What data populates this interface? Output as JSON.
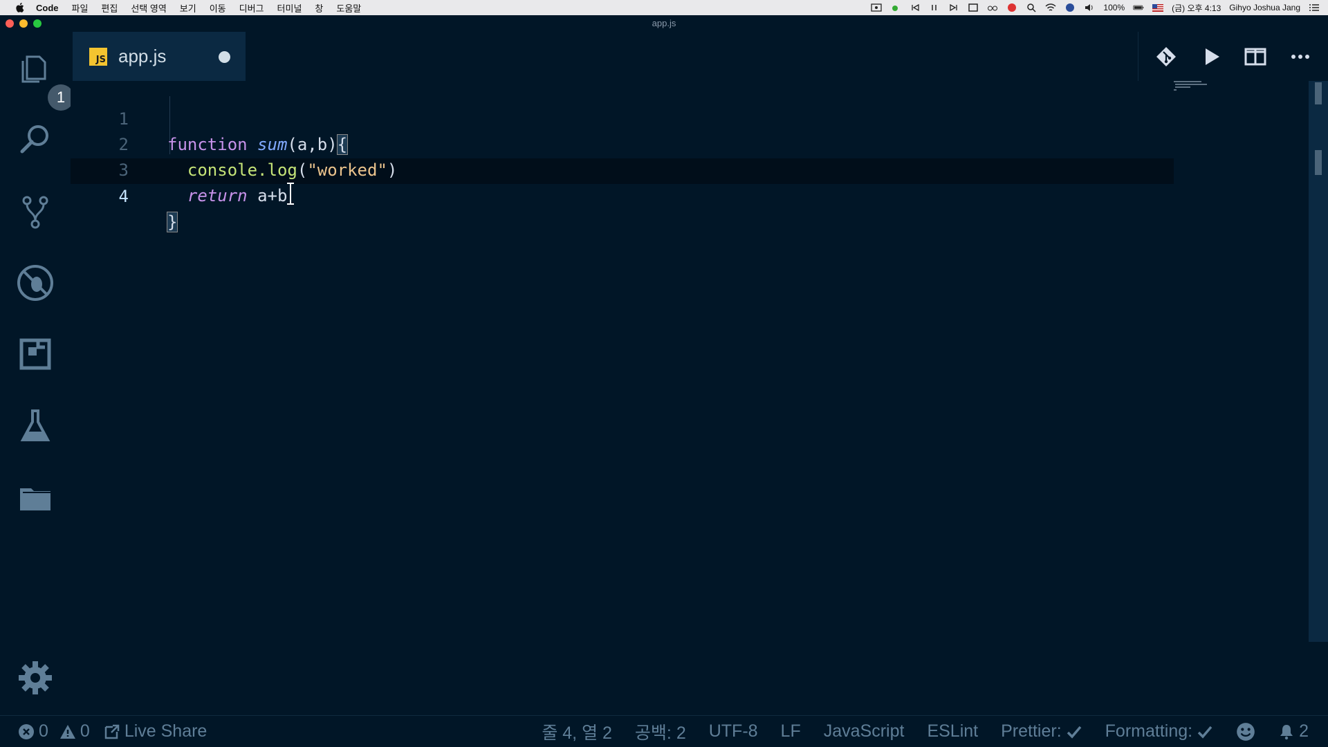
{
  "menubar": {
    "app_name": "Code",
    "menus": [
      "파일",
      "편집",
      "선택 영역",
      "보기",
      "이동",
      "디버그",
      "터미널",
      "창",
      "도움말"
    ],
    "battery": "100%",
    "clock": "(금) 오후 4:13",
    "user": "Gihyo Joshua Jang"
  },
  "window": {
    "title": "app.js"
  },
  "activity_bar": {
    "explorer_badge": "1",
    "icons": [
      "files-icon",
      "search-icon",
      "source-control-icon",
      "debug-icon",
      "extensions-icon",
      "test-flask-icon",
      "folder-icon"
    ],
    "settings_icon": "gear-icon"
  },
  "tabs": [
    {
      "label": "app.js",
      "icon": "JS",
      "dirty": true,
      "active": true
    }
  ],
  "editor": {
    "active_line": 4,
    "lines": [
      {
        "number": "1"
      },
      {
        "number": "2"
      },
      {
        "number": "3"
      },
      {
        "number": "4"
      }
    ],
    "tokens": {
      "l1_kw": "function",
      "l1_fn": "sum",
      "l1_params": "(a,b)",
      "l1_brace": "{",
      "l2_obj": "console.",
      "l2_method": "log",
      "l2_open": "(",
      "l2_str": "\"worked\"",
      "l2_close": ")",
      "l3_kw": "return",
      "l3_expr": "a+b",
      "l4_brace": "}"
    }
  },
  "statusbar": {
    "errors": "0",
    "warnings": "0",
    "live_share": "Live Share",
    "position": "줄 4, 열 2",
    "spaces": "공백: 2",
    "encoding": "UTF-8",
    "eol": "LF",
    "language": "JavaScript",
    "eslint": "ESLint",
    "prettier": "Prettier:",
    "formatting": "Formatting:",
    "notifications": "2"
  },
  "colors": {
    "background": "#011627",
    "tab_active": "#0b2942",
    "keyword": "#c792ea",
    "function": "#82aaff",
    "method": "#c5e478",
    "string": "#ecc48d",
    "status_text": "#5f7e97"
  }
}
